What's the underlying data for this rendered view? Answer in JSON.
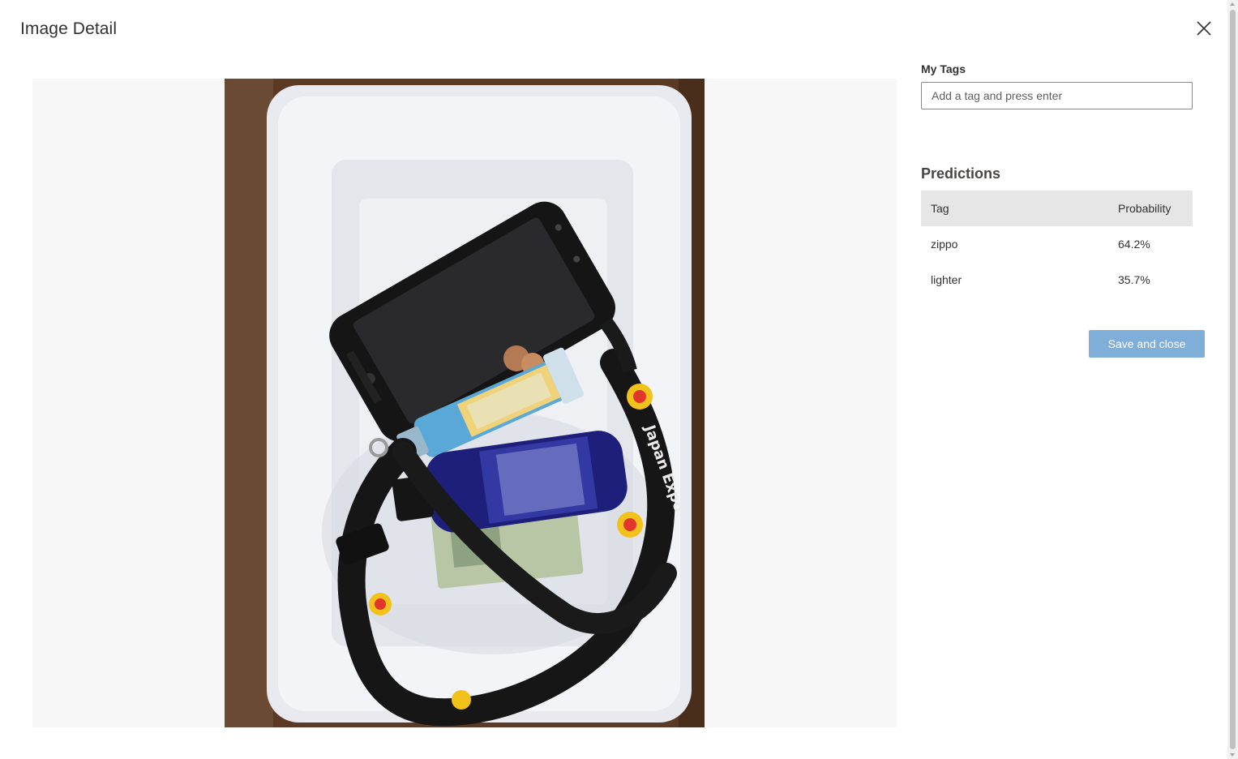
{
  "dialog": {
    "title": "Image Detail",
    "close_icon": "close-icon"
  },
  "image": {
    "alt": "photo of phone, lighter, lanyard and bottle in a white tray",
    "lanyard_text": "Japan Expo"
  },
  "tags": {
    "label": "My Tags",
    "placeholder": "Add a tag and press enter",
    "value": ""
  },
  "predictions": {
    "title": "Predictions",
    "columns": [
      "Tag",
      "Probability"
    ],
    "rows": [
      {
        "tag": "zippo",
        "probability": "64.2%"
      },
      {
        "tag": "lighter",
        "probability": "35.7%"
      }
    ]
  },
  "actions": {
    "save_label": "Save and close"
  },
  "colors": {
    "primary_disabled": "#7faed8",
    "header_bg": "#e6e6e6",
    "image_bg": "#f7f7f7"
  }
}
